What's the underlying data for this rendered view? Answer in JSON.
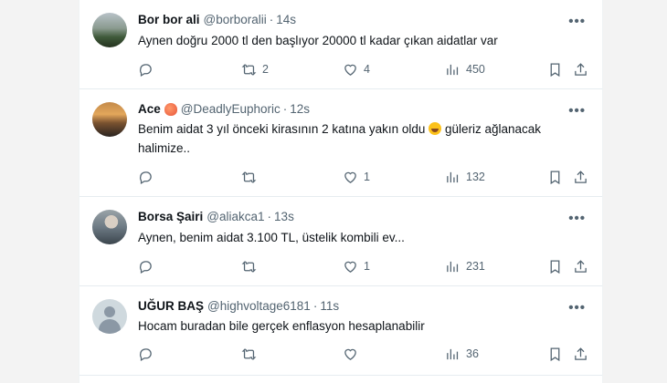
{
  "tweets": [
    {
      "name": "Bor bor ali",
      "handle": "@borboralii",
      "time": "14s",
      "text": "Aynen doğru 2000 tl den başlıyor 20000  tl kadar çıkan aidatlar var",
      "replies": "",
      "retweets": "2",
      "likes": "4",
      "views": "450",
      "avatar": "landscape-photo"
    },
    {
      "name": "Ace",
      "name_emoji": "peach-emoji",
      "handle": "@DeadlyEuphoric",
      "time": "12s",
      "text_a": "Benim aidat 3 yıl önceki kirasının 2 katına yakın oldu",
      "text_emoji": "rolling-laughing-emoji",
      "text_b": "güleriz ağlanacak halimize..",
      "replies": "",
      "retweets": "",
      "likes": "1",
      "views": "132",
      "avatar": "sunset-photo"
    },
    {
      "name": "Borsa Şairi",
      "handle": "@aliakca1",
      "time": "13s",
      "text": "Aynen, benim aidat 3.100 TL, üstelik kombili ev...",
      "replies": "",
      "retweets": "",
      "likes": "1",
      "views": "231",
      "avatar": "person-photo"
    },
    {
      "name": "UĞUR BAŞ",
      "handle": "@highvoltage6181",
      "time": "11s",
      "text": "Hocam buradan bile gerçek enflasyon hesaplanabilir",
      "replies": "",
      "retweets": "",
      "likes": "",
      "views": "36",
      "avatar": "default-avatar"
    }
  ],
  "ui": {
    "separator": "·",
    "more": "•••"
  }
}
